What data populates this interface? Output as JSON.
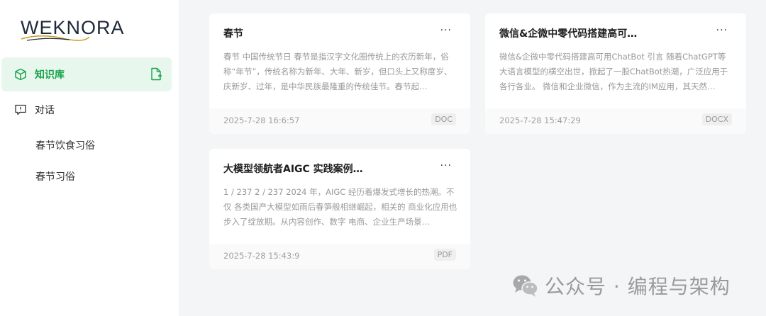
{
  "sidebar": {
    "logo": "WEKNORA",
    "nav": [
      {
        "label": "知识库",
        "icon": "knowledge-base-icon",
        "active": true
      },
      {
        "label": "对话",
        "icon": "chat-icon",
        "active": false
      }
    ],
    "conversations": [
      "春节饮食习俗",
      "春节习俗"
    ]
  },
  "cards": [
    {
      "title": "春节",
      "desc": "春节 中国传统节日 春节是指汉字文化圈传统上的农历新年，俗称“年节”，传统名称为新年、大年、新岁，但口头上又称度岁、庆新岁、过年，是中华民族最隆重的传统佳节。春节起…",
      "date": "2025-7-28 16:6:57",
      "type": "DOC"
    },
    {
      "title": "微信&企微中零代码搭建高可…",
      "desc": "微信&企微中零代码搭建高可用ChatBot 引言 随着ChatGPT等大语言模型的横空出世，掀起了一股ChatBot热潮，广泛应用于各行各业。 微信和企业微信，作为主流的IM应用，其天然…",
      "date": "2025-7-28 15:47:29",
      "type": "DOCX"
    },
    {
      "title": "大模型领航者AIGC 实践案例…",
      "desc": "1 / 237 2 / 237 2024 年，AIGC 经历着爆发式增长的热潮。不仅 各类国产大模型如雨后春笋般相继崛起，相关的 商业化应用也步入了绽放期。从内容创作、数字 电商、企业生产场景…",
      "date": "2025-7-28 15:43:9",
      "type": "PDF"
    }
  ],
  "more_label": "···",
  "watermark": "公众号 · 编程与架构",
  "colors": {
    "accent": "#16a34a",
    "active_bg": "#e8f7ee",
    "page_bg": "#f4f5f7"
  }
}
